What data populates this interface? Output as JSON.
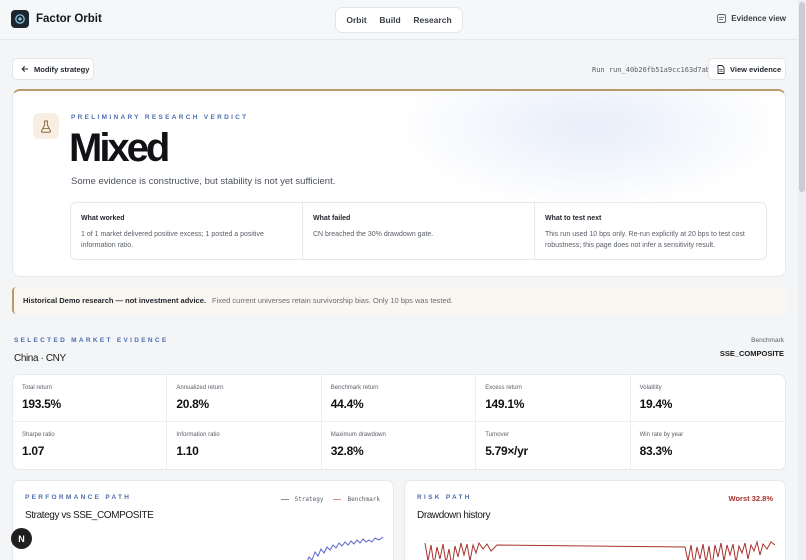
{
  "header": {
    "brand": "Factor Orbit",
    "nav": [
      "Orbit",
      "Build",
      "Research"
    ],
    "evidence_view": "Evidence view"
  },
  "toolbar": {
    "modify": "Modify strategy",
    "run_prefix": "Run",
    "run_id": "run_40b26fb51a9cc163d7ab",
    "view_evidence": "View evidence"
  },
  "verdict": {
    "kicker": "PRELIMINARY RESEARCH VERDICT",
    "word": "Mixed",
    "summary": "Some evidence is constructive, but stability is not yet sufficient.",
    "findings": [
      {
        "title": "What worked",
        "body": "1 of 1 market delivered positive excess; 1 posted a positive information ratio."
      },
      {
        "title": "What failed",
        "body": "CN breached the 30% drawdown gate."
      },
      {
        "title": "What to test next",
        "body": "This run used 10 bps only. Re-run explicitly at 20 bps to test cost robustness; this page does not infer a sensitivity result."
      }
    ]
  },
  "disclaimer": {
    "strong": "Historical Demo research — not investment advice.",
    "note": "Fixed current universes retain survivorship bias. Only 10 bps was tested."
  },
  "market": {
    "kicker": "SELECTED MARKET EVIDENCE",
    "name": "China · CNY",
    "benchmark_label": "Benchmark",
    "benchmark": "SSE_COMPOSITE",
    "metrics": [
      {
        "label": "Total return",
        "value": "193.5%"
      },
      {
        "label": "Annualized return",
        "value": "20.8%"
      },
      {
        "label": "Benchmark return",
        "value": "44.4%"
      },
      {
        "label": "Excess return",
        "value": "149.1%"
      },
      {
        "label": "Volatility",
        "value": "19.4%"
      },
      {
        "label": "Sharpe ratio",
        "value": "1.07"
      },
      {
        "label": "Information ratio",
        "value": "1.10"
      },
      {
        "label": "Maximum drawdown",
        "value": "32.8%"
      },
      {
        "label": "Turnover",
        "value": "5.79×/yr"
      },
      {
        "label": "Win rate by year",
        "value": "83.3%"
      }
    ]
  },
  "performance": {
    "kicker": "PERFORMANCE PATH",
    "title": "Strategy vs SSE_COMPOSITE",
    "legend": {
      "strategy": "Strategy",
      "benchmark": "Benchmark"
    },
    "strategy_color": "#5a63c9",
    "benchmark_color": "#d98a86"
  },
  "risk": {
    "kicker": "RISK PATH",
    "title": "Drawdown history",
    "worst": "Worst 32.8%",
    "color": "#a8322d"
  },
  "fab": {
    "label": "N"
  }
}
